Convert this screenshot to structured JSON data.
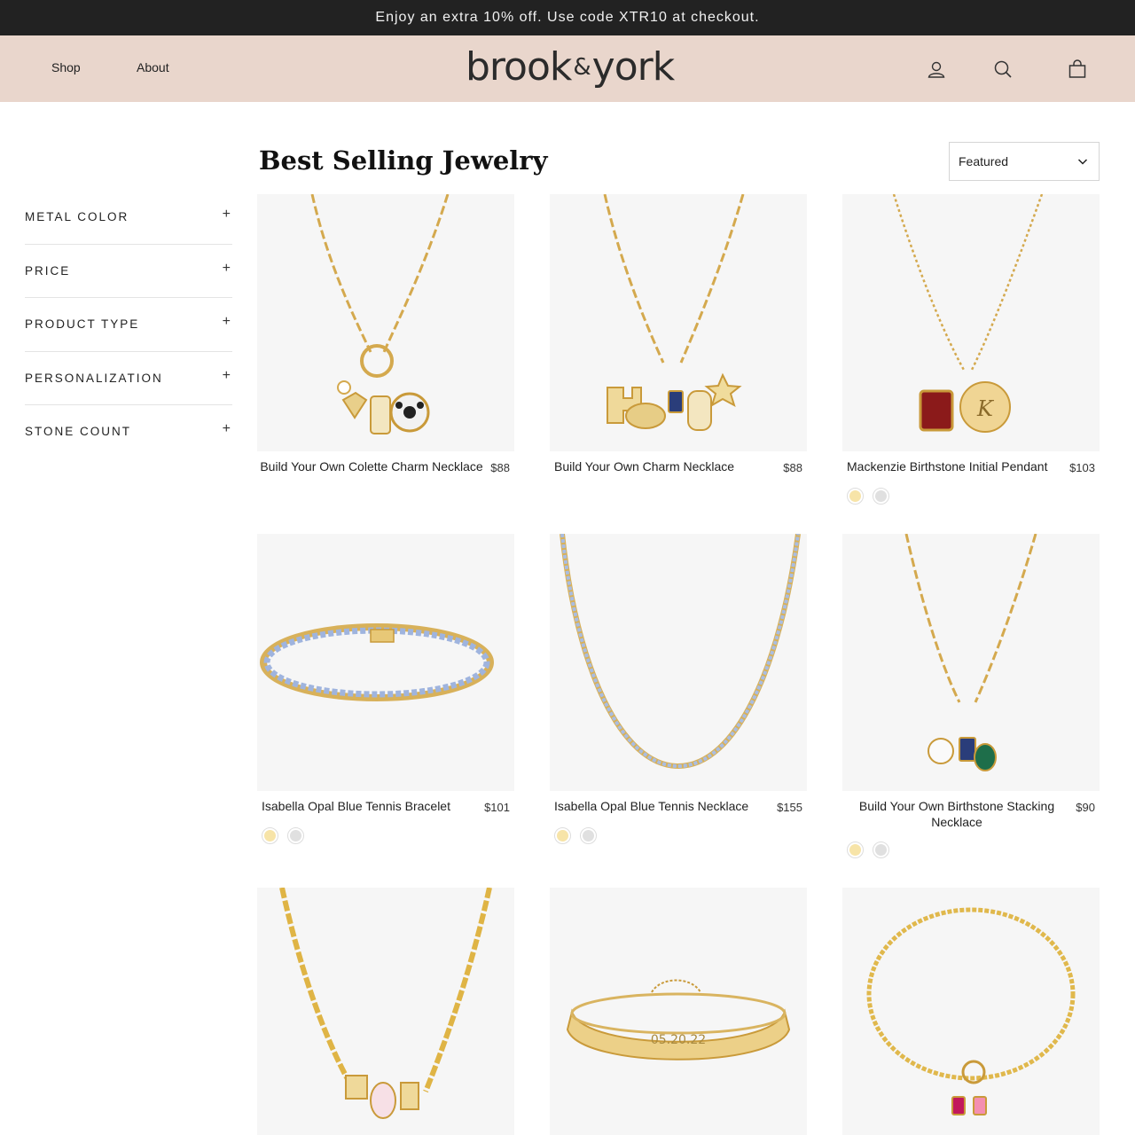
{
  "announcement": "Enjoy an extra 10% off. Use code XTR10 at checkout.",
  "header": {
    "nav": [
      "Shop",
      "About"
    ],
    "logo_left": "brook",
    "logo_amp": "&",
    "logo_right": "york",
    "icons": [
      "account-icon",
      "search-icon",
      "cart-icon"
    ]
  },
  "page_title": "Best Selling Jewelry",
  "sort": {
    "selected": "Featured"
  },
  "filters": [
    "METAL COLOR",
    "PRICE",
    "PRODUCT TYPE",
    "PERSONALIZATION",
    "STONE COUNT"
  ],
  "filter_toggle": "+",
  "colors": {
    "gold": "#f7e4a8",
    "silver": "#e0e0e0",
    "header_bg": "#e9d6cc",
    "announce_bg": "#222222"
  },
  "products": [
    {
      "name": "Build Your Own Colette Charm Necklace",
      "price": "$88",
      "swatches": []
    },
    {
      "name": "Build Your Own Charm Necklace",
      "price": "$88",
      "swatches": []
    },
    {
      "name": "Mackenzie Birthstone Initial Pendant",
      "price": "$103",
      "swatches": [
        "gold",
        "silver"
      ]
    },
    {
      "name": "Isabella Opal Blue Tennis Bracelet",
      "price": "$101",
      "swatches": [
        "gold",
        "silver"
      ]
    },
    {
      "name": "Isabella Opal Blue Tennis Necklace",
      "price": "$155",
      "swatches": [
        "gold",
        "silver"
      ]
    },
    {
      "name": "Build Your Own Birthstone Stacking Necklace",
      "price": "$90",
      "swatches": [
        "gold",
        "silver"
      ]
    },
    {
      "name": "",
      "price": "",
      "swatches": []
    },
    {
      "name": "",
      "price": "",
      "swatches": []
    },
    {
      "name": "",
      "price": "",
      "swatches": []
    }
  ],
  "engraving": "05.20.22",
  "charm_initial": "K"
}
